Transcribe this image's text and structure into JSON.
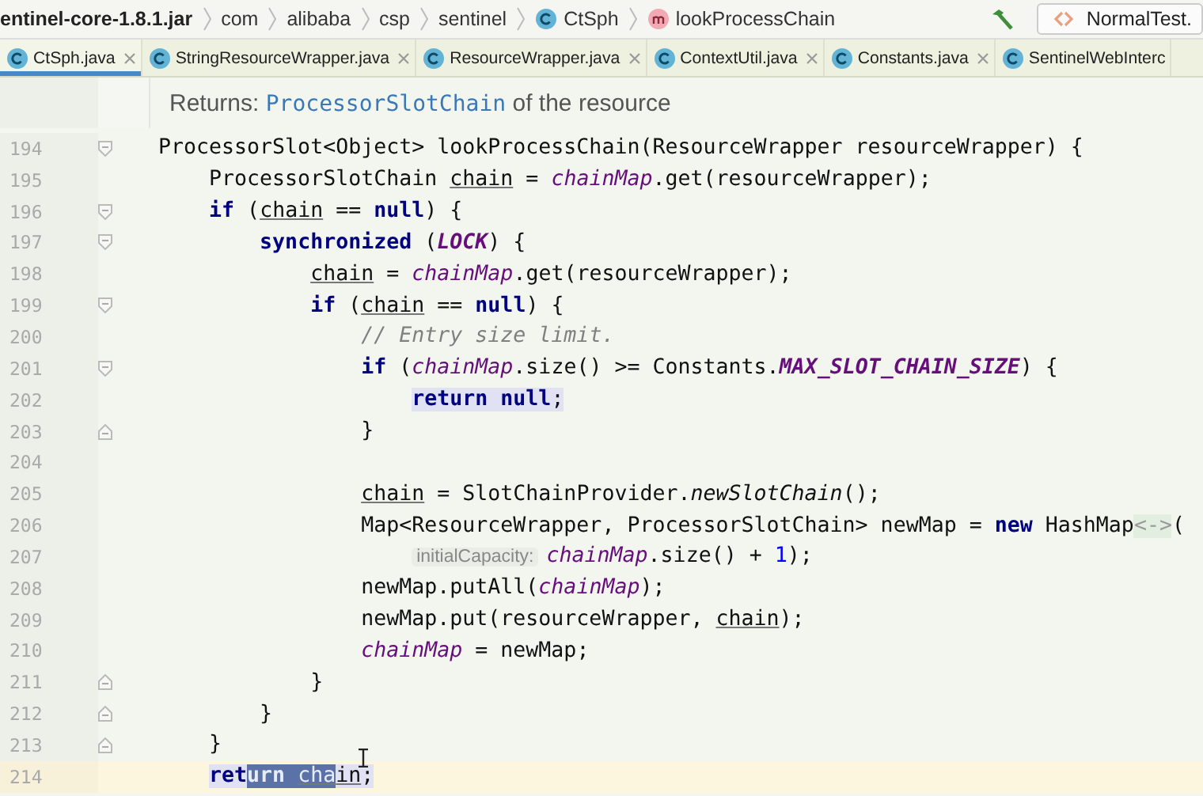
{
  "breadcrumb": [
    {
      "label": "entinel-core-1.8.1.jar",
      "kind": "jar"
    },
    {
      "label": "com",
      "kind": "package"
    },
    {
      "label": "alibaba",
      "kind": "package"
    },
    {
      "label": "csp",
      "kind": "package"
    },
    {
      "label": "sentinel",
      "kind": "package"
    },
    {
      "label": "CtSph",
      "kind": "class"
    },
    {
      "label": "lookProcessChain",
      "kind": "method"
    }
  ],
  "run_config": {
    "label": "NormalTest."
  },
  "tabs": [
    {
      "label": "CtSph.java",
      "selected": true,
      "closable": true
    },
    {
      "label": "StringResourceWrapper.java",
      "selected": false,
      "closable": true
    },
    {
      "label": "ResourceWrapper.java",
      "selected": false,
      "closable": true
    },
    {
      "label": "ContextUtil.java",
      "selected": false,
      "closable": true
    },
    {
      "label": "Constants.java",
      "selected": false,
      "closable": true
    },
    {
      "label": "SentinelWebInterc",
      "selected": false,
      "closable": false
    }
  ],
  "doc": {
    "prefix": "Returns:",
    "link": "ProcessorSlotChain",
    "suffix": "of the resource"
  },
  "lines": [
    {
      "number": "194",
      "kind": "fold-start",
      "current": false,
      "highlighted": false,
      "tokens": [
        {
          "kind": "plain",
          "text": "ProcessorSlot<Object> lookProcessChain(ResourceWrapper resourceWrapper) {"
        }
      ]
    },
    {
      "number": "195",
      "kind": "plain",
      "current": false,
      "highlighted": false,
      "tokens": [
        {
          "kind": "plain",
          "text": "    ProcessorSlotChain "
        },
        {
          "kind": "var",
          "text": "chain"
        },
        {
          "kind": "plain",
          "text": " = "
        },
        {
          "kind": "field",
          "text": "chainMap"
        },
        {
          "kind": "plain",
          "text": ".get(resourceWrapper);"
        }
      ]
    },
    {
      "number": "196",
      "kind": "fold-start",
      "current": false,
      "highlighted": false,
      "tokens": [
        {
          "kind": "keyword",
          "text": "    if"
        },
        {
          "kind": "plain",
          "text": " ("
        },
        {
          "kind": "var",
          "text": "chain"
        },
        {
          "kind": "plain",
          "text": " == "
        },
        {
          "kind": "keyword",
          "text": "null"
        },
        {
          "kind": "plain",
          "text": ") {"
        }
      ]
    },
    {
      "number": "197",
      "kind": "fold-start",
      "current": false,
      "highlighted": false,
      "tokens": [
        {
          "kind": "keyword",
          "text": "        synchronized"
        },
        {
          "kind": "plain",
          "text": " ("
        },
        {
          "kind": "static",
          "text": "LOCK"
        },
        {
          "kind": "plain",
          "text": ") {"
        }
      ]
    },
    {
      "number": "198",
      "kind": "plain",
      "current": false,
      "highlighted": false,
      "tokens": [
        {
          "kind": "var",
          "text": "            chain"
        },
        {
          "kind": "plain",
          "text": " = "
        },
        {
          "kind": "field",
          "text": "chainMap"
        },
        {
          "kind": "plain",
          "text": ".get(resourceWrapper);"
        }
      ]
    },
    {
      "number": "199",
      "kind": "fold-start",
      "current": false,
      "highlighted": false,
      "tokens": [
        {
          "kind": "keyword",
          "text": "            if"
        },
        {
          "kind": "plain",
          "text": " ("
        },
        {
          "kind": "var",
          "text": "chain"
        },
        {
          "kind": "plain",
          "text": " == "
        },
        {
          "kind": "keyword",
          "text": "null"
        },
        {
          "kind": "plain",
          "text": ") {"
        }
      ]
    },
    {
      "number": "200",
      "kind": "plain",
      "current": false,
      "highlighted": false,
      "tokens": [
        {
          "kind": "comment",
          "text": "                // Entry size limit."
        }
      ]
    },
    {
      "number": "201",
      "kind": "fold-start",
      "current": false,
      "highlighted": false,
      "tokens": [
        {
          "kind": "keyword",
          "text": "                if"
        },
        {
          "kind": "plain",
          "text": " ("
        },
        {
          "kind": "field",
          "text": "chainMap"
        },
        {
          "kind": "plain",
          "text": ".size() >= Constants."
        },
        {
          "kind": "static",
          "text": "MAX_SLOT_CHAIN_SIZE"
        },
        {
          "kind": "plain",
          "text": ") {"
        }
      ]
    },
    {
      "number": "202",
      "kind": "plain",
      "current": false,
      "highlighted": true,
      "tokens": [
        {
          "kind": "keyword",
          "text": "return"
        },
        {
          "kind": "keyword",
          "text": " null"
        },
        {
          "kind": "plain",
          "text": ";"
        }
      ]
    },
    {
      "number": "203",
      "kind": "fold-end",
      "current": false,
      "highlighted": false,
      "tokens": [
        {
          "kind": "plain",
          "text": "                }"
        }
      ]
    },
    {
      "number": "204",
      "kind": "plain",
      "current": false,
      "highlighted": false
    },
    {
      "number": "205",
      "kind": "plain",
      "current": false,
      "highlighted": false,
      "tokens": [
        {
          "kind": "var",
          "text": "                chain"
        },
        {
          "kind": "plain",
          "text": " = SlotChainProvider."
        },
        {
          "kind": "method",
          "text": "newSlotChain"
        },
        {
          "kind": "plain",
          "text": "();"
        }
      ]
    },
    {
      "number": "206",
      "kind": "plain",
      "current": false,
      "highlighted": false,
      "tokens": [
        {
          "kind": "plain",
          "text": "                Map<ResourceWrapper, ProcessorSlotChain> newMap = "
        },
        {
          "kind": "keyword",
          "text": "new"
        },
        {
          "kind": "plain",
          "text": " HashMap"
        },
        {
          "kind": "diamond",
          "text": "<->"
        },
        {
          "kind": "plain",
          "text": "("
        }
      ]
    },
    {
      "number": "207",
      "kind": "plain",
      "current": false,
      "highlighted": false,
      "hint": "initialCapacity:",
      "tokens": [
        {
          "kind": "field",
          "text": "chainMap"
        },
        {
          "kind": "plain",
          "text": ".size() + "
        },
        {
          "kind": "number",
          "text": "1"
        },
        {
          "kind": "plain",
          "text": ");"
        }
      ]
    },
    {
      "number": "208",
      "kind": "plain",
      "current": false,
      "highlighted": false,
      "tokens": [
        {
          "kind": "plain",
          "text": "                newMap.putAll("
        },
        {
          "kind": "field",
          "text": "chainMap"
        },
        {
          "kind": "plain",
          "text": ");"
        }
      ]
    },
    {
      "number": "209",
      "kind": "plain",
      "current": false,
      "highlighted": false,
      "tokens": [
        {
          "kind": "plain",
          "text": "                newMap.put(resourceWrapper, "
        },
        {
          "kind": "var",
          "text": "chain"
        },
        {
          "kind": "plain",
          "text": ");"
        }
      ]
    },
    {
      "number": "210",
      "kind": "plain",
      "current": false,
      "highlighted": false,
      "tokens": [
        {
          "kind": "field",
          "text": "                chainMap"
        },
        {
          "kind": "plain",
          "text": " = newMap;"
        }
      ]
    },
    {
      "number": "211",
      "kind": "fold-end",
      "current": false,
      "highlighted": false,
      "tokens": [
        {
          "kind": "plain",
          "text": "            }"
        }
      ]
    },
    {
      "number": "212",
      "kind": "fold-end",
      "current": false,
      "highlighted": false,
      "tokens": [
        {
          "kind": "plain",
          "text": "        }"
        }
      ]
    },
    {
      "number": "213",
      "kind": "fold-end",
      "current": false,
      "highlighted": false,
      "tokens": [
        {
          "kind": "plain",
          "text": "    }"
        }
      ]
    },
    {
      "number": "214",
      "kind": "plain",
      "current": true,
      "highlighted": true,
      "tokens": [
        {
          "kind": "keyword",
          "text": "ret",
          "selected": false
        },
        {
          "kind": "keyword",
          "text": "urn ",
          "selected": true
        },
        {
          "kind": "var",
          "text": "cha",
          "selected": true
        },
        {
          "kind": "var",
          "text": "in",
          "selected": false
        },
        {
          "kind": "plain",
          "text": ";",
          "selected": false
        }
      ]
    }
  ]
}
